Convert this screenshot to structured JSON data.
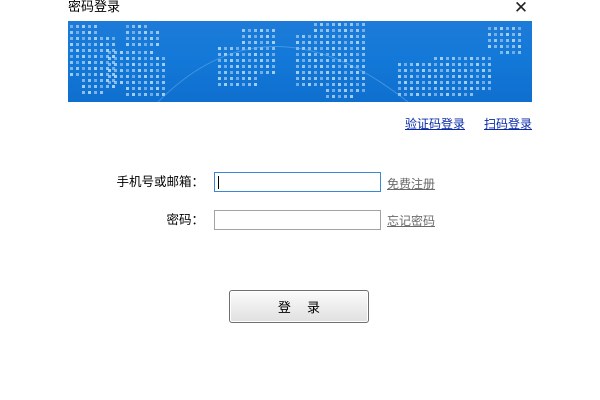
{
  "window": {
    "title": "密码登录",
    "close_glyph": "✕"
  },
  "banner": {
    "background_color": "#1379d8",
    "dot_color": "#b9dbf6"
  },
  "links": {
    "sms_login": "验证码登录",
    "scan_login": "扫码登录"
  },
  "form": {
    "phone_label": "手机号或邮箱：",
    "phone_value": "",
    "password_label": "密码：",
    "password_value": "",
    "register_link": "免费注册",
    "forgot_link": "忘记密码"
  },
  "login_button": "登 录",
  "colors": {
    "link": "#0a2aa8",
    "secondary_link": "#6a6a6a",
    "focus_border": "#3c86d8"
  }
}
